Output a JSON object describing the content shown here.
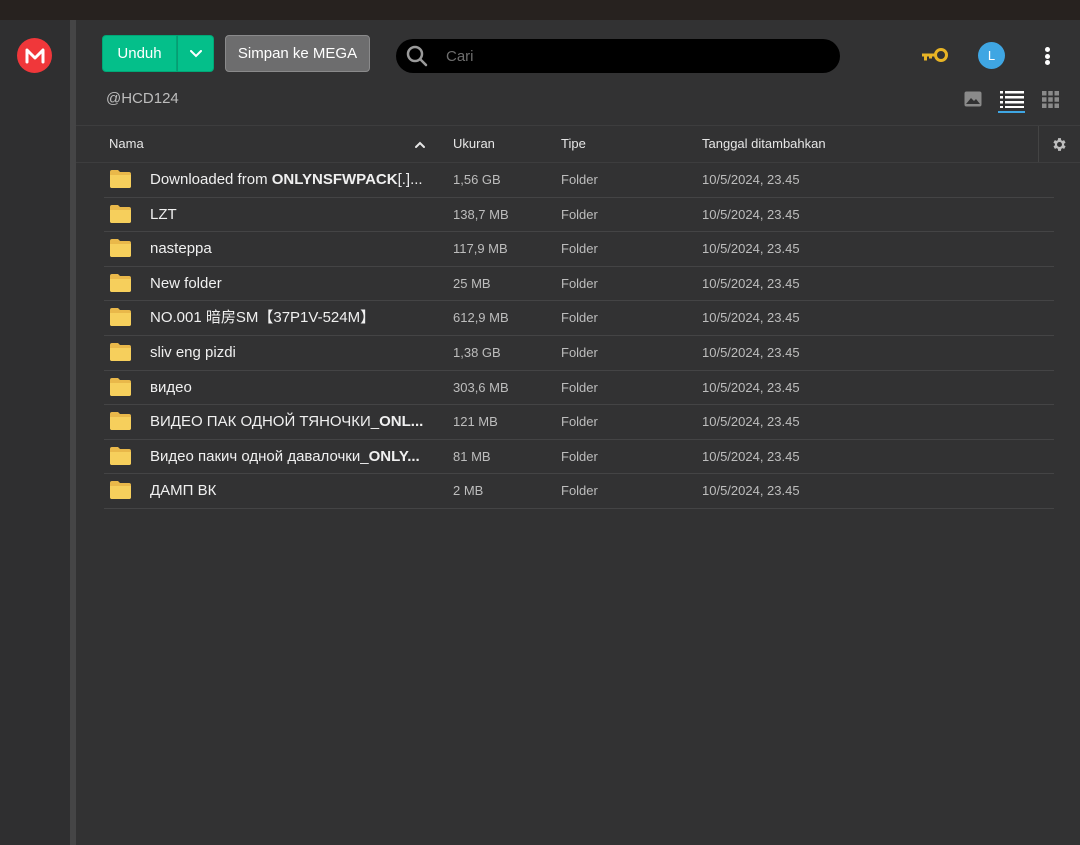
{
  "colors": {
    "accent_green": "#04bf8a",
    "mega_red": "#f0373a",
    "avatar_blue": "#3fa6e3",
    "key_yellow": "#e8b425",
    "folder_yellow": "#f6cf5c"
  },
  "app": {
    "logo_letter": "M"
  },
  "toolbar": {
    "download_label": "Unduh",
    "save_label": "Simpan ke MEGA",
    "search_placeholder": "Cari",
    "search_value": "",
    "avatar_initial": "L"
  },
  "folder": {
    "owner": "@HCD124"
  },
  "table": {
    "headers": {
      "name": "Nama",
      "size": "Ukuran",
      "type": "Tipe",
      "date": "Tanggal ditambahkan"
    },
    "rows": [
      {
        "name_plain": "Downloaded from ",
        "name_bold": "ONLYNSFWPACK",
        "name_rest": "[.]...",
        "size": "1,56 GB",
        "type": "Folder",
        "date": "10/5/2024, 23.45"
      },
      {
        "name_plain": "LZT",
        "name_bold": "",
        "name_rest": "",
        "size": "138,7 MB",
        "type": "Folder",
        "date": "10/5/2024, 23.45"
      },
      {
        "name_plain": "nasteppa",
        "name_bold": "",
        "name_rest": "",
        "size": "117,9 MB",
        "type": "Folder",
        "date": "10/5/2024, 23.45"
      },
      {
        "name_plain": "New folder",
        "name_bold": "",
        "name_rest": "",
        "size": "25 MB",
        "type": "Folder",
        "date": "10/5/2024, 23.45"
      },
      {
        "name_plain": "NO.001 暗房SM【37P1V-524M】",
        "name_bold": "",
        "name_rest": "",
        "size": "612,9 MB",
        "type": "Folder",
        "date": "10/5/2024, 23.45"
      },
      {
        "name_plain": "sliv eng pizdi",
        "name_bold": "",
        "name_rest": "",
        "size": "1,38 GB",
        "type": "Folder",
        "date": "10/5/2024, 23.45"
      },
      {
        "name_plain": "видео",
        "name_bold": "",
        "name_rest": "",
        "size": "303,6 MB",
        "type": "Folder",
        "date": "10/5/2024, 23.45"
      },
      {
        "name_plain": "ВИДЕО ПАК ОДНОЙ ТЯНОЧКИ_",
        "name_bold": "ONL...",
        "name_rest": "",
        "size": "121 MB",
        "type": "Folder",
        "date": "10/5/2024, 23.45"
      },
      {
        "name_plain": "Видео пакич одной давалочки_",
        "name_bold": "ONLY...",
        "name_rest": "",
        "size": "81 MB",
        "type": "Folder",
        "date": "10/5/2024, 23.45"
      },
      {
        "name_plain": "ДАМП ВК",
        "name_bold": "",
        "name_rest": "",
        "size": "2 MB",
        "type": "Folder",
        "date": "10/5/2024, 23.45"
      }
    ]
  }
}
